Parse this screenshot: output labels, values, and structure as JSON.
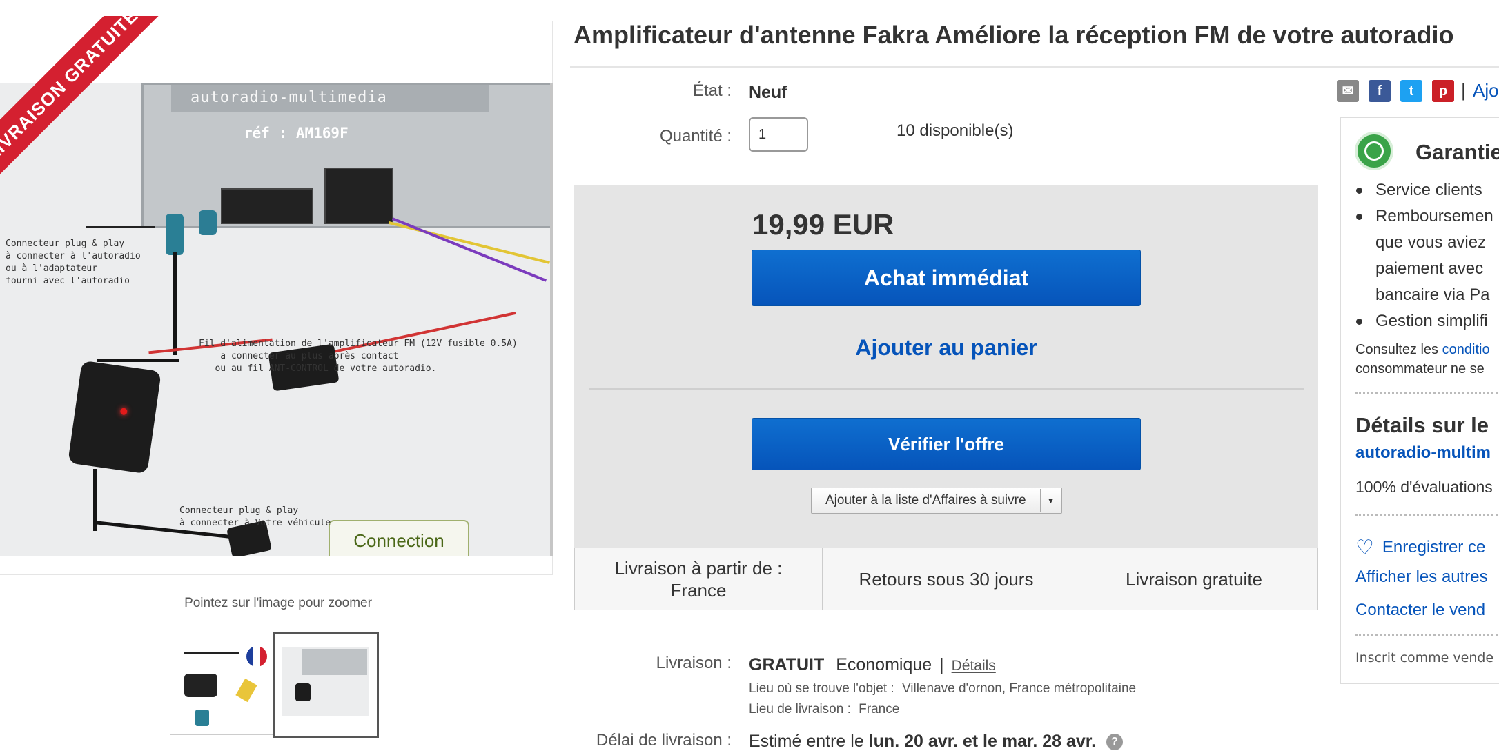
{
  "listing": {
    "title": "Amplificateur d'antenne Fakra Améliore la réception FM de votre autoradio"
  },
  "image_panel": {
    "ribbon": "LIVRAISON GRATUITE",
    "device_brand": "autoradio-multimedia",
    "device_ref": "réf : AM169F",
    "annotation_left": "Connecteur plug & play\nà connecter à l'autoradio\nou à l'adaptateur\nfourni avec l'autoradio",
    "annotation_power": "Fil d'alimentation de l'amplificateur FM (12V fusible 0.5A)\n    a connecter au plus après contact\n   ou au fil ANT-CONTROL de votre autoradio.",
    "annotation_vehicle": "Connecteur plug & play\nà connecter à Votre véhicule",
    "connection_label": "Connection",
    "zoom_hint": "Pointez sur l'image pour zoomer"
  },
  "details": {
    "state_label": "État :",
    "state_value": "Neuf",
    "quantity_label": "Quantité :",
    "quantity_value": "1",
    "available": "10 disponible(s)"
  },
  "buybox": {
    "price": "19,99 EUR",
    "buy_now": "Achat immédiat",
    "add_to_cart": "Ajouter au panier",
    "check_offer": "Vérifier l'offre",
    "watch_list": "Ajouter à la liste d'Affaires à suivre"
  },
  "info_strip": {
    "ship_from_line1": "Livraison à partir de :",
    "ship_from_line2": "France",
    "returns": "Retours sous 30 jours",
    "free_shipping": "Livraison gratuite"
  },
  "shipping": {
    "label": "Livraison :",
    "free": "GRATUIT",
    "method": "Economique",
    "details_link": "Détails",
    "item_location_label": "Lieu où se trouve l'objet :",
    "item_location": "Villenave d'ornon, France métropolitaine",
    "delivery_to_label": "Lieu de livraison :",
    "delivery_to": "France",
    "delay_label": "Délai de livraison :",
    "delay_prefix": "Estimé entre le",
    "delay_dates": "lun. 20 avr. et le mar. 28 avr.",
    "help": "?"
  },
  "share": {
    "email": "✉",
    "facebook": "f",
    "twitter": "t",
    "pinterest": "p",
    "separator": "|",
    "more": "Ajo"
  },
  "right_panel": {
    "heading": "Garantie",
    "bullets": [
      "Service clients",
      "Remboursemen",
      "que vous aviez",
      "paiement avec",
      "bancaire via Pa",
      "Gestion simplifi"
    ],
    "note_prefix": "Consultez les",
    "note_link": "conditio",
    "note_line2": "consommateur ne se",
    "seller_heading": "Détails sur le",
    "seller_name": "autoradio-multim",
    "evaluations": "100% d'évaluations",
    "save_seller": "Enregistrer ce",
    "other_items": "Afficher les autres",
    "contact": "Contacter le vend",
    "registered": "Inscrit comme vende"
  },
  "colors": {
    "link_blue": "#0654ba",
    "ribbon_red": "#d42030",
    "buybox_grey": "#e5e5e5",
    "guarantee_green": "#3aa348"
  }
}
